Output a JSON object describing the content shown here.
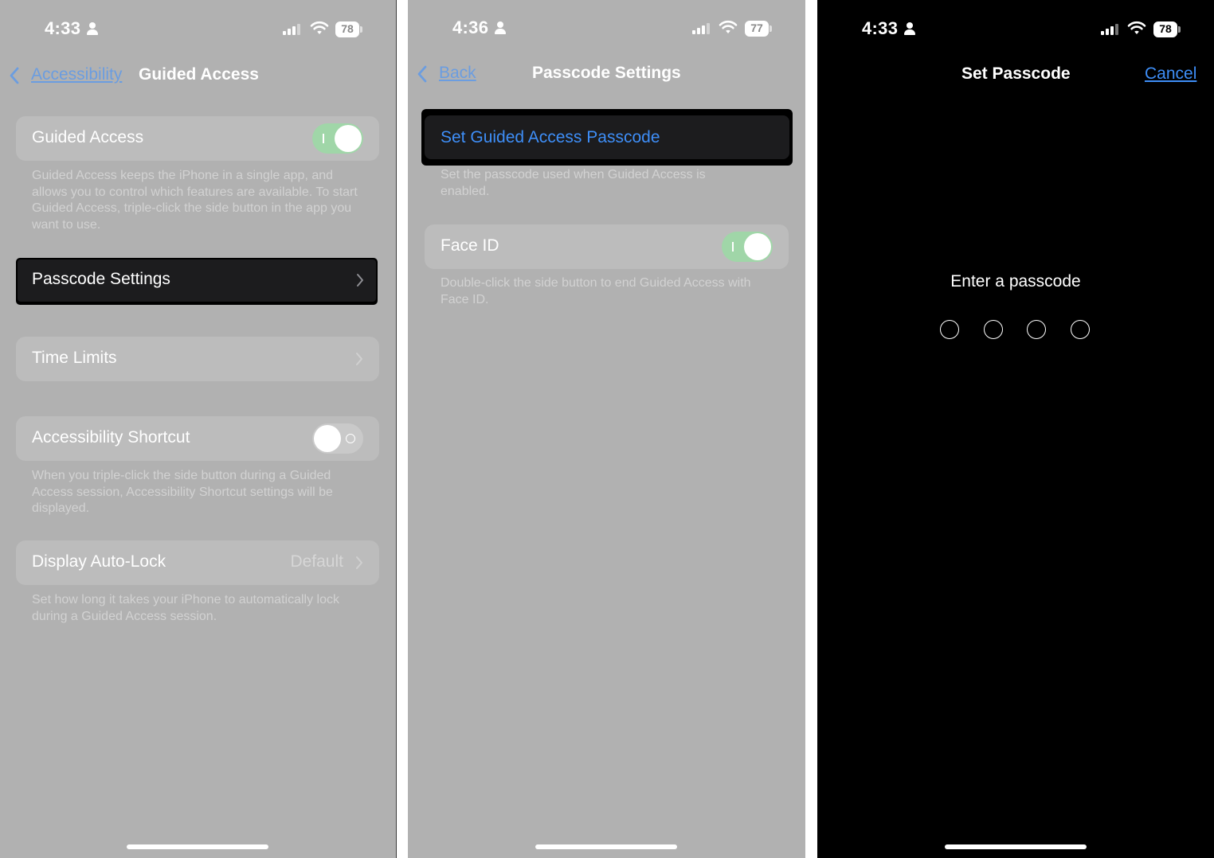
{
  "screen1": {
    "status": {
      "time": "4:33",
      "battery": "78"
    },
    "nav": {
      "back_label": "Accessibility",
      "title": "Guided Access"
    },
    "guided_access": {
      "label": "Guided Access",
      "toggle_on": true,
      "footnote": "Guided Access keeps the iPhone in a single app, and allows you to control which features are available. To start Guided Access, triple-click the side button in the app you want to use."
    },
    "passcode_settings": {
      "label": "Passcode Settings"
    },
    "time_limits": {
      "label": "Time Limits"
    },
    "accessibility_shortcut": {
      "label": "Accessibility Shortcut",
      "toggle_on": false,
      "footnote": "When you triple-click the side button during a Guided Access session, Accessibility Shortcut settings will be displayed."
    },
    "display_auto_lock": {
      "label": "Display Auto-Lock",
      "value": "Default",
      "footnote": "Set how long it takes your iPhone to automatically lock during a Guided Access session."
    }
  },
  "screen2": {
    "status": {
      "time": "4:36",
      "battery": "77"
    },
    "nav": {
      "back_label": "Back",
      "title": "Passcode Settings"
    },
    "set_passcode": {
      "label": "Set Guided Access Passcode",
      "footnote": "Set the passcode used when Guided Access is enabled."
    },
    "face_id": {
      "label": "Face ID",
      "toggle_on": true,
      "footnote": "Double-click the side button to end Guided Access with Face ID."
    }
  },
  "screen3": {
    "status": {
      "time": "4:33",
      "battery": "78"
    },
    "nav": {
      "title": "Set Passcode",
      "cancel_label": "Cancel"
    },
    "prompt": "Enter a passcode",
    "digits_entered": 0,
    "digits_total": 4
  },
  "colors": {
    "panel_bg": "#b1b1b1",
    "cell_bg": "#bcbcbc",
    "link_blue": "#3e8ef7",
    "toggle_green": "#a0d6a8",
    "dark_bg": "#000000"
  },
  "icons": [
    "chevron-left-icon",
    "chevron-right-icon",
    "person-icon",
    "cellular-signal-icon",
    "wifi-icon",
    "battery-icon"
  ]
}
